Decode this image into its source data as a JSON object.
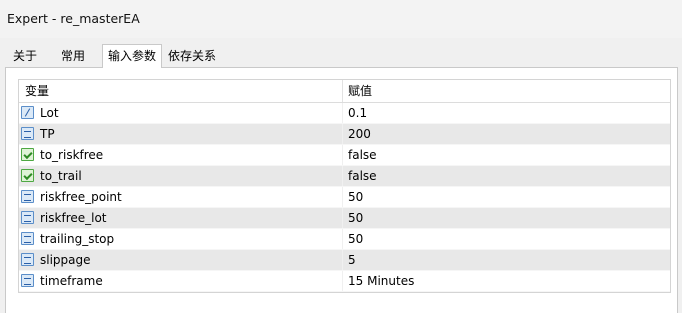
{
  "window": {
    "title": "Expert - re_masterEA"
  },
  "tabs": [
    {
      "label": "关于"
    },
    {
      "label": "常用"
    },
    {
      "label": "输入参数",
      "active": true
    },
    {
      "label": "依存关系"
    }
  ],
  "table": {
    "headers": {
      "variable": "变量",
      "value": "赋值"
    },
    "rows": [
      {
        "icon": "fraction-type-icon",
        "name": "Lot",
        "value": "0.1"
      },
      {
        "icon": "integer-type-icon",
        "name": "TP",
        "value": "200"
      },
      {
        "icon": "boolean-type-icon",
        "name": "to_riskfree",
        "value": "false"
      },
      {
        "icon": "boolean-type-icon",
        "name": "to_trail",
        "value": "false"
      },
      {
        "icon": "integer-type-icon",
        "name": "riskfree_point",
        "value": "50"
      },
      {
        "icon": "integer-type-icon",
        "name": "riskfree_lot",
        "value": "50"
      },
      {
        "icon": "integer-type-icon",
        "name": "trailing_stop",
        "value": "50"
      },
      {
        "icon": "integer-type-icon",
        "name": "slippage",
        "value": "5"
      },
      {
        "icon": "integer-type-icon",
        "name": "timeframe",
        "value": "15 Minutes"
      }
    ]
  }
}
